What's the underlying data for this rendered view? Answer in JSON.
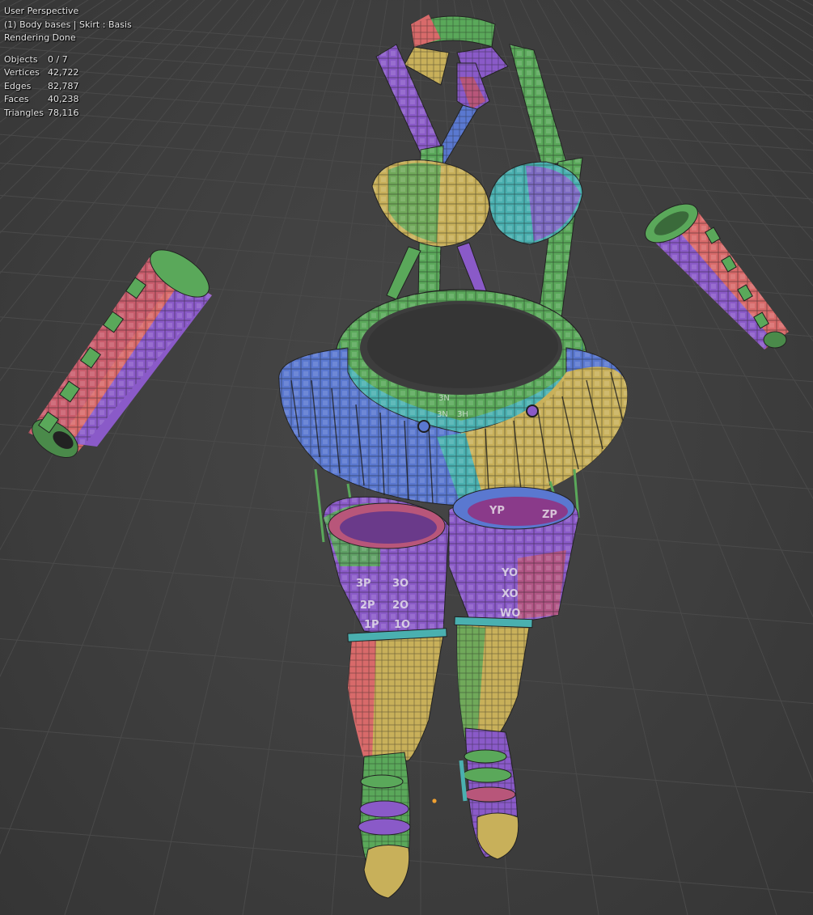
{
  "viewport": {
    "view_name": "User Perspective",
    "active_object": "(1) Body bases | Skirt : Basis",
    "status": "Rendering Done"
  },
  "stats": [
    {
      "label": "Objects",
      "value": "0 / 7"
    },
    {
      "label": "Vertices",
      "value": "42,722"
    },
    {
      "label": "Edges",
      "value": "82,787"
    },
    {
      "label": "Faces",
      "value": "40,238"
    },
    {
      "label": "Triangles",
      "value": "78,116"
    }
  ],
  "uv_grid_labels": [
    "3N",
    "3N",
    "3H",
    "3P",
    "3O",
    "2P",
    "2O",
    "1P",
    "1O",
    "YO",
    "XO",
    "WO",
    "YP",
    "ZP"
  ],
  "colors": {
    "background": "#3d3d3d",
    "grid_line": "#4a4a4a",
    "overlay_text": "#e6e6e6",
    "origin_point": "#f0a030",
    "uv_palette": [
      "#5aa85a",
      "#8a5ac8",
      "#5a78d0",
      "#d86a6a",
      "#c8b05a",
      "#4ab0b0",
      "#b8567a"
    ]
  }
}
